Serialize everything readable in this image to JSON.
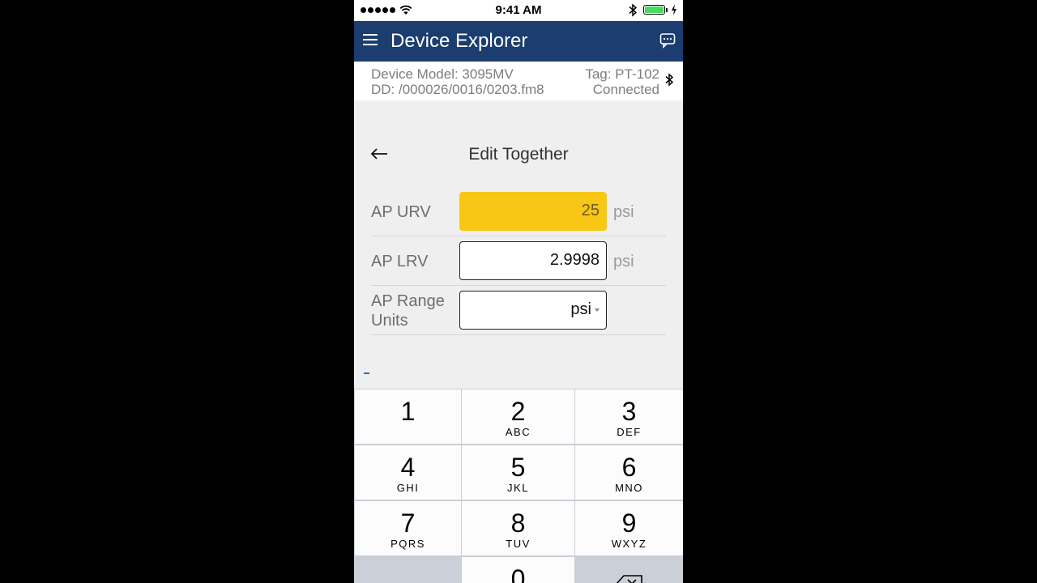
{
  "status_bar": {
    "time": "9:41 AM",
    "signal_icon": "signal-dots-icon",
    "wifi_icon": "wifi-icon",
    "bluetooth_icon": "bluetooth-icon",
    "battery_icon": "battery-icon",
    "battery_color": "#4cd964"
  },
  "nav": {
    "title": "Device Explorer",
    "menu_icon": "menu-icon",
    "chat_icon": "chat-bubble-icon",
    "bar_color": "#1b3d6f"
  },
  "device_info": {
    "model_line": "Device Model:  3095MV",
    "dd_line": "DD: /000026/0016/0203.fm8",
    "tag_line": "Tag:  PT-102",
    "status": "Connected"
  },
  "edit": {
    "title": "Edit Together",
    "back_icon": "back-arrow-icon"
  },
  "form": {
    "rows": [
      {
        "label": "AP URV",
        "value": "25",
        "unit": "psi"
      },
      {
        "label": "AP LRV",
        "value": "2.9998",
        "unit": "psi"
      },
      {
        "label": "AP Range Units",
        "value": "psi"
      }
    ],
    "highlight_color": "#f8c614"
  },
  "keypad": {
    "keys": [
      {
        "num": "1",
        "letters": ""
      },
      {
        "num": "2",
        "letters": "ABC"
      },
      {
        "num": "3",
        "letters": "DEF"
      },
      {
        "num": "4",
        "letters": "GHI"
      },
      {
        "num": "5",
        "letters": "JKL"
      },
      {
        "num": "6",
        "letters": "MNO"
      },
      {
        "num": "7",
        "letters": "PQRS"
      },
      {
        "num": "8",
        "letters": "TUV"
      },
      {
        "num": "9",
        "letters": "WXYZ"
      },
      {
        "num": "0",
        "letters": ""
      }
    ],
    "delete_icon": "backspace-icon"
  }
}
